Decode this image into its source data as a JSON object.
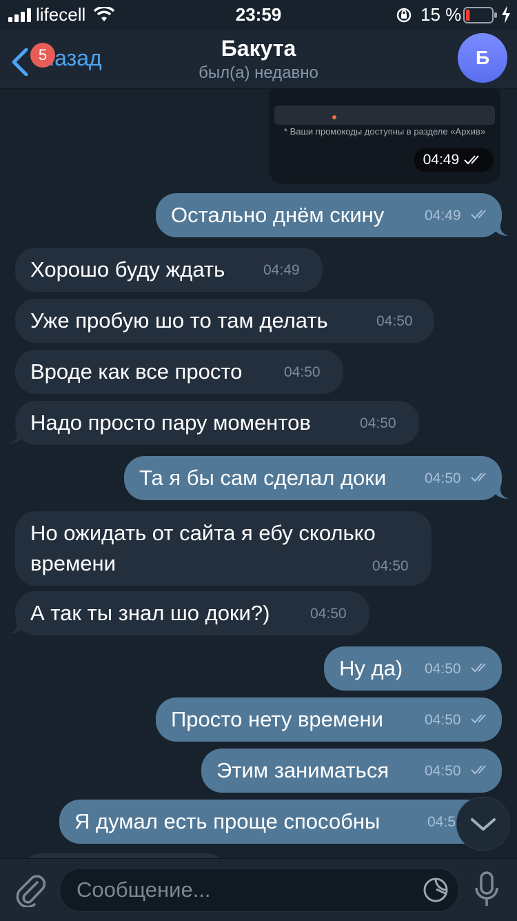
{
  "status_bar": {
    "carrier": "lifecell",
    "time": "23:59",
    "battery_percent": "15 %",
    "battery_level": 0.15,
    "battery_color": "#ff3b30"
  },
  "header": {
    "back_label": "Назад",
    "unread_badge": "5",
    "title": "Бакута",
    "subtitle": "был(а) недавно",
    "avatar_letter": "Б",
    "accent_color": "#4ea4f6"
  },
  "photo_message": {
    "caption": "* Ваши промокоды доступны в разделе «Архив»",
    "time": "04:49"
  },
  "messages": [
    {
      "dir": "out",
      "text": "Остально днём скину",
      "time": "04:49"
    },
    {
      "dir": "in",
      "text": "Хорошо буду ждать",
      "time": "04:49"
    },
    {
      "dir": "in",
      "text": "Уже пробую шо то там делать",
      "time": "04:50"
    },
    {
      "dir": "in",
      "text": "Вроде как все просто",
      "time": "04:50"
    },
    {
      "dir": "in",
      "text": "Надо просто пару моментов",
      "time": "04:50"
    },
    {
      "dir": "out",
      "text": "Та я бы сам сделал доки",
      "time": "04:50"
    },
    {
      "dir": "in",
      "text_line1": "Но ожидать от сайта я ебу сколько",
      "text_line2": "времени",
      "time": "04:50"
    },
    {
      "dir": "in",
      "text": "А так ты знал шо доки?)",
      "time": "04:50"
    },
    {
      "dir": "out",
      "text": "Ну да)",
      "time": "04:50"
    },
    {
      "dir": "out",
      "text": "Просто нету времени",
      "time": "04:50"
    },
    {
      "dir": "out",
      "text": "Этим заниматься",
      "time": "04:50"
    },
    {
      "dir": "out",
      "text": "Я думал есть проще способны",
      "time": "04:5"
    }
  ],
  "composer": {
    "placeholder": "Сообщение..."
  },
  "icons": {
    "attach": "paperclip-icon",
    "sticker": "sticker-icon",
    "mic": "microphone-icon",
    "scroll": "chevron-down-icon"
  }
}
